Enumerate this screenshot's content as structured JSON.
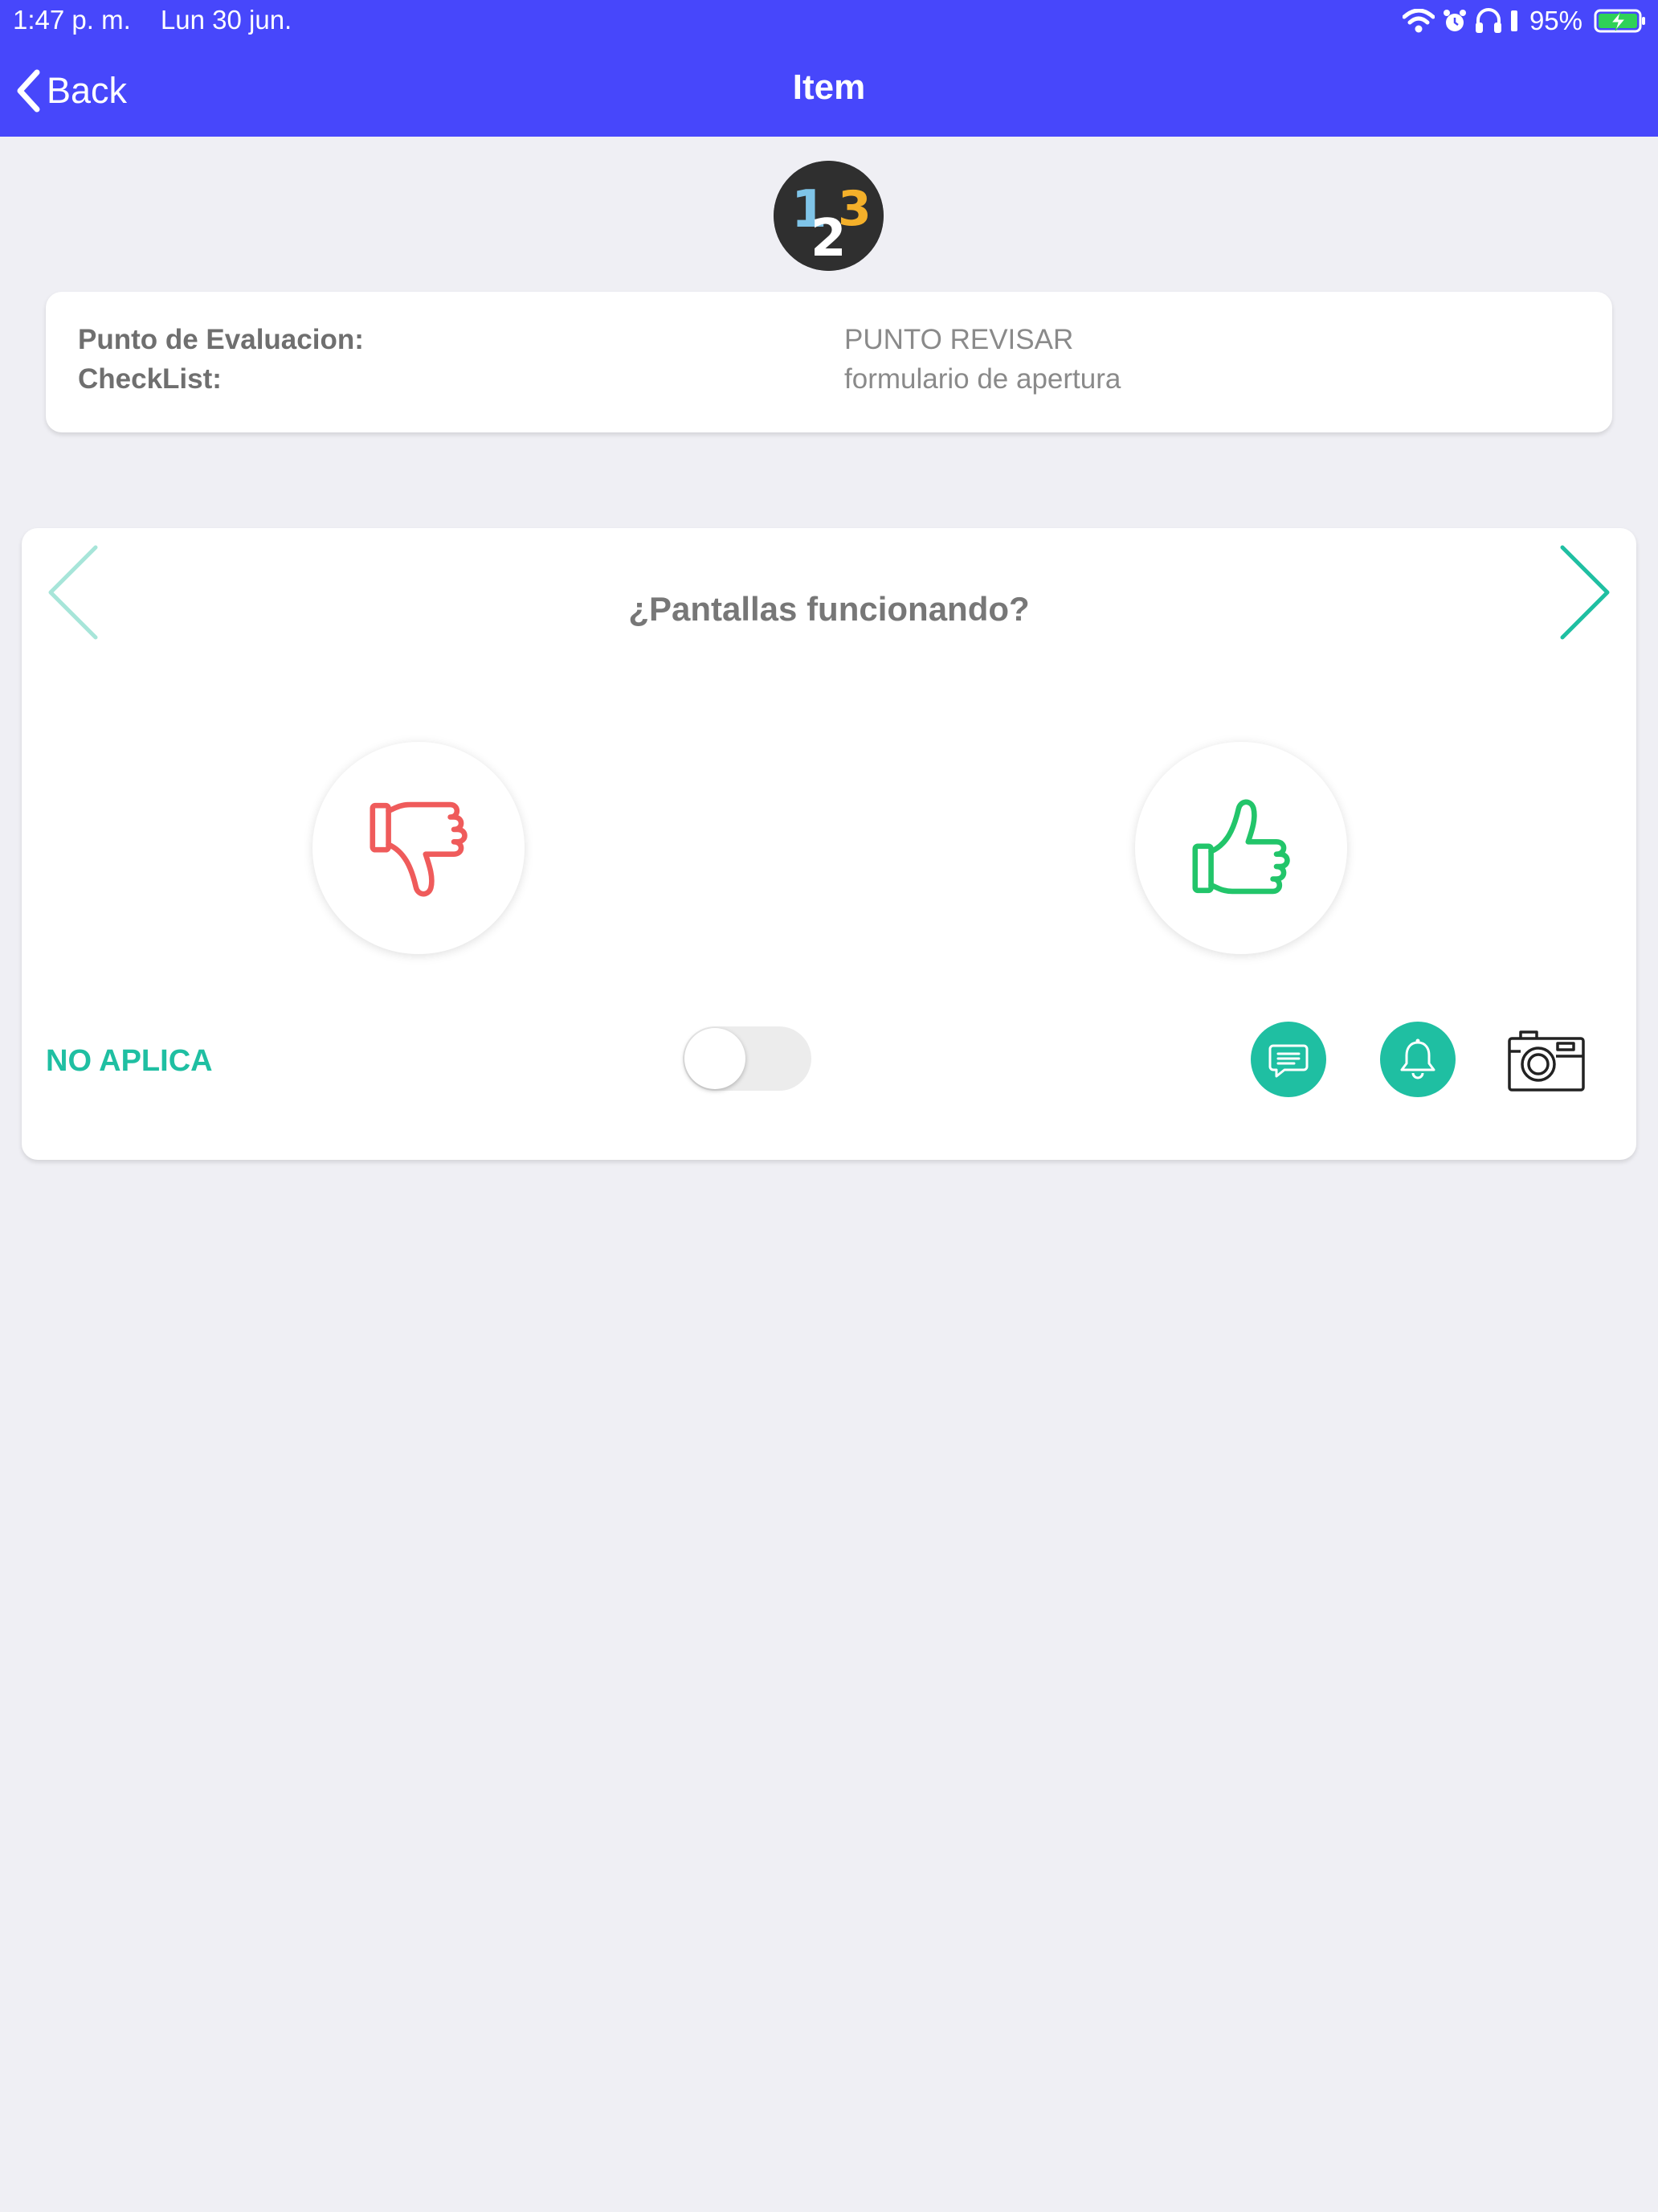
{
  "status_bar": {
    "time": "1:47 p. m.",
    "date": "Lun 30 jun.",
    "battery": "95%",
    "icons": [
      "wifi-icon",
      "alarm-icon",
      "headphones-icon",
      "battery-charging-icon"
    ]
  },
  "nav": {
    "back_label": "Back",
    "title": "Item"
  },
  "logo": {
    "digits": [
      "1",
      "2",
      "3"
    ]
  },
  "info": {
    "evaluation_point_label": "Punto de Evaluacion:",
    "evaluation_point_value": "PUNTO REVISAR",
    "checklist_label": "CheckList:",
    "checklist_value": "formulario de apertura"
  },
  "question": {
    "text": "¿Pantallas funcionando?",
    "not_applicable_label": "NO APLICA",
    "not_applicable_on": false,
    "actions": [
      "comment-icon",
      "bell-icon",
      "camera-icon"
    ]
  },
  "colors": {
    "header": "#4747fb",
    "accent": "#1fbfa2",
    "thumbs_down": "#ef5b5b",
    "thumbs_up": "#22c56a",
    "background": "#efeff4"
  }
}
